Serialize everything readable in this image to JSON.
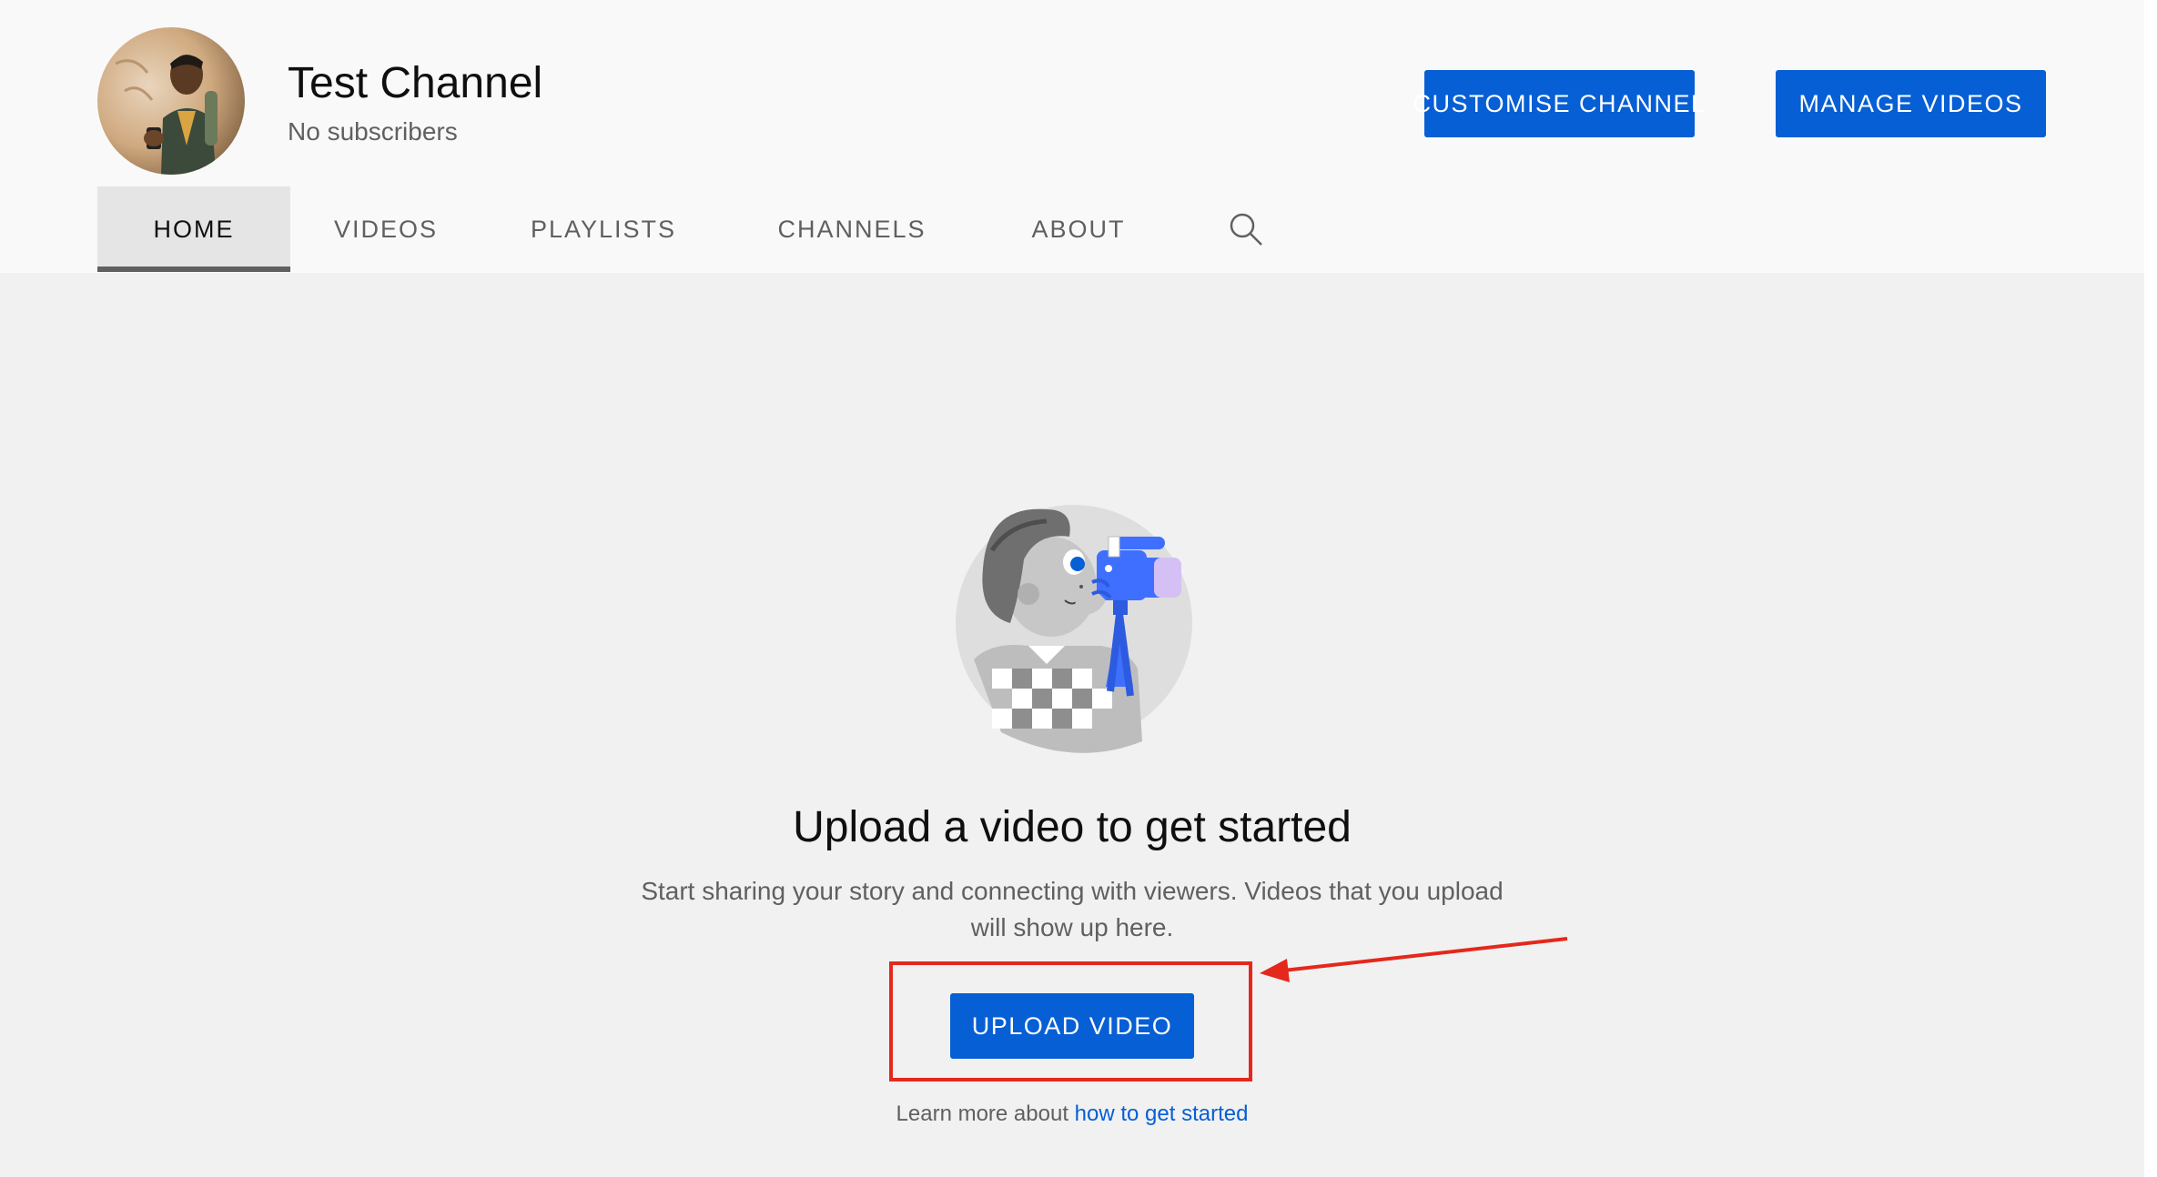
{
  "channel": {
    "name": "Test Channel",
    "subscribers": "No subscribers",
    "avatar_icon": "profile-photo"
  },
  "header_buttons": {
    "customise_label": "CUSTOMISE CHANNEL",
    "manage_label": "MANAGE VIDEOS"
  },
  "tabs": [
    {
      "label": "HOME",
      "active": true
    },
    {
      "label": "VIDEOS",
      "active": false
    },
    {
      "label": "PLAYLISTS",
      "active": false
    },
    {
      "label": "CHANNELS",
      "active": false
    },
    {
      "label": "ABOUT",
      "active": false
    }
  ],
  "search_icon": "search-icon",
  "empty_state": {
    "title": "Upload a video to get started",
    "description": "Start sharing your story and connecting with viewers. Videos that you upload will show up here.",
    "upload_label": "UPLOAD VIDEO",
    "learn_prefix": "Learn more about",
    "learn_link": "how to get started"
  },
  "colors": {
    "accent": "#065fd4",
    "annotation": "#e4281c"
  }
}
